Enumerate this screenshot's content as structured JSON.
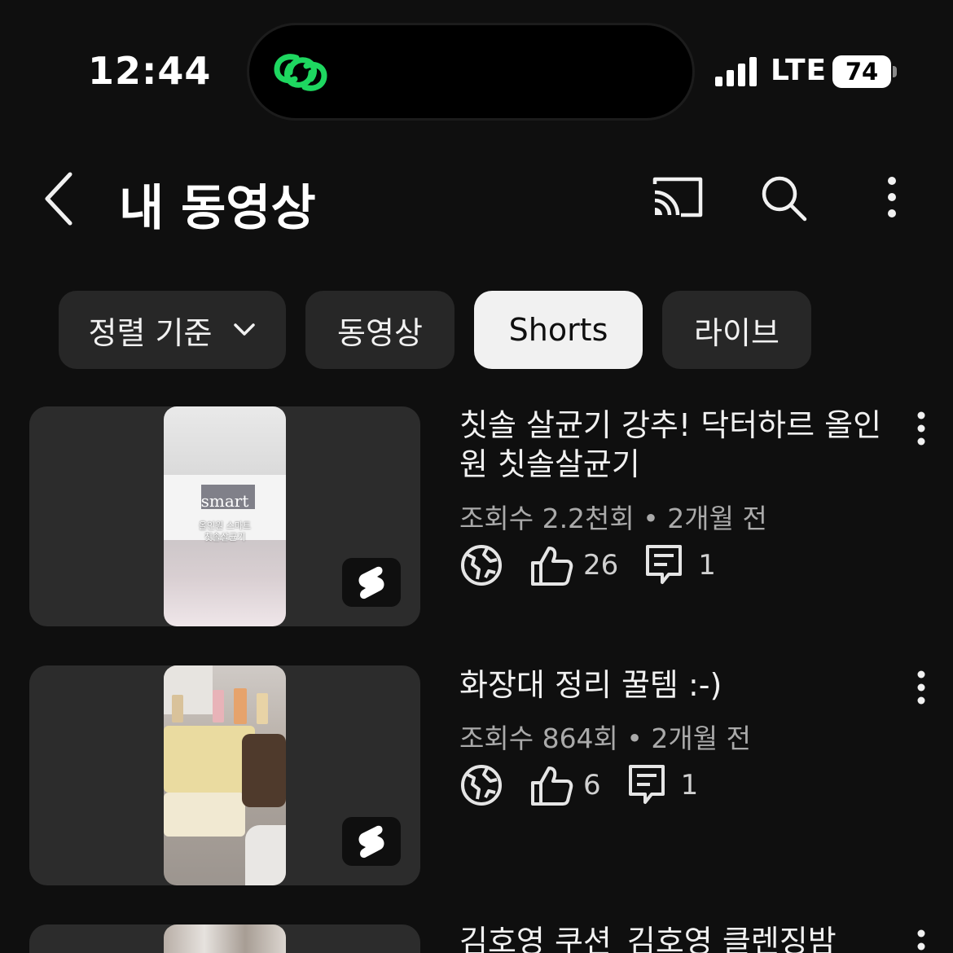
{
  "status_bar": {
    "time": "12:44",
    "network": "LTE",
    "battery": "74"
  },
  "header": {
    "title": "내 동영상"
  },
  "chips": [
    {
      "label": "정렬 기준"
    },
    {
      "label": "동영상"
    },
    {
      "label": "Shorts"
    },
    {
      "label": "라이브"
    }
  ],
  "videos": [
    {
      "title": "칫솔 살균기 강추! 닥터하르 올인원 칫솔살균기",
      "views": "조회수 2.2천회",
      "age": "2개월 전",
      "likes": "26",
      "comments": "1",
      "thumb_text": [
        "smart",
        "올인원 스마트",
        "칫솔살균기"
      ]
    },
    {
      "title": "화장대 정리 꿀템 :-)",
      "views": "조회수 864회",
      "age": "2개월 전",
      "likes": "6",
      "comments": "1"
    },
    {
      "title": "김호영 쿠션_김호영 클렌징밤"
    }
  ],
  "colors": {
    "island_icon": "#1ed760",
    "active_chip": "#f1f1f1",
    "chip": "#272727",
    "background": "#0f0f0f"
  },
  "icons": [
    "back-arrow-icon",
    "cast-icon",
    "search-icon",
    "more-vert-icon",
    "chevron-down-icon",
    "globe-icon",
    "thumbs-up-icon",
    "comment-icon",
    "shorts-logo-icon"
  ]
}
